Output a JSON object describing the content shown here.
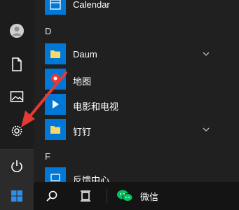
{
  "start_menu": {
    "apps": [
      {
        "label": "Calendar"
      },
      {
        "label": "Daum"
      },
      {
        "label": "地图"
      },
      {
        "label": "电影和电视"
      },
      {
        "label": "钉钉"
      },
      {
        "label": "反馈中心"
      }
    ],
    "letters": [
      "D",
      "F"
    ],
    "rail_icons": [
      "avatar",
      "document-icon",
      "pictures-icon",
      "settings-gear-icon",
      "power-icon"
    ]
  },
  "taskbar": {
    "wechat_label": "微信"
  },
  "colors": {
    "accent": "#0078d7",
    "folder": "#f6d86b",
    "maps_red": "#e53935",
    "wechat_green": "#07c160",
    "annotation_arrow": "#e53935"
  }
}
